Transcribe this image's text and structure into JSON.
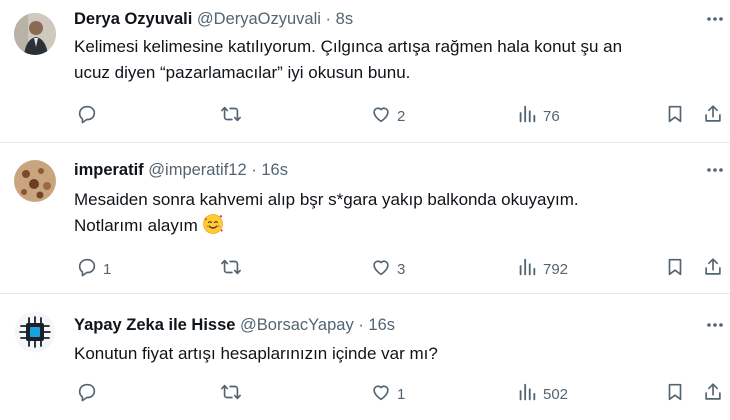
{
  "tweets": [
    {
      "name": "Derya Ozyuvali",
      "handle": "@DeryaOzyuvali",
      "separator": "·",
      "time": "8s",
      "text_line1": "Kelimesi kelimesine katılıyorum. Çılgınca artışa rağmen hala konut şu an",
      "text_line2": "ucuz diyen “pazarlamacılar” iyi okusun bunu.",
      "reply_count": "",
      "retweet_count": "",
      "like_count": "2",
      "view_count": "76"
    },
    {
      "name": "imperatif",
      "handle": "@imperatif12",
      "separator": "·",
      "time": "16s",
      "text_line1": "Mesaiden sonra kahvemi alıp bşr s*gara yakıp balkonda okuyayım.",
      "text_line2": "Notlarımı alayım",
      "emoji": "smiling-face-with-hearts",
      "reply_count": "1",
      "retweet_count": "",
      "like_count": "3",
      "view_count": "792"
    },
    {
      "name": "Yapay Zeka ile Hisse",
      "handle": "@BorsacYapay",
      "separator": "·",
      "time": "16s",
      "text_line1": "Konutun fiyat artışı hesaplarınızın içinde var mı?",
      "reply_count": "",
      "retweet_count": "",
      "like_count": "1",
      "view_count": "502"
    }
  ],
  "colors": {
    "text": "#0f1419",
    "secondary": "#536471",
    "divider": "#e6e9eb",
    "background": "#ffffff"
  },
  "icons": [
    "reply-icon",
    "retweet-icon",
    "like-icon",
    "views-icon",
    "bookmark-icon",
    "share-icon",
    "more-icon"
  ]
}
